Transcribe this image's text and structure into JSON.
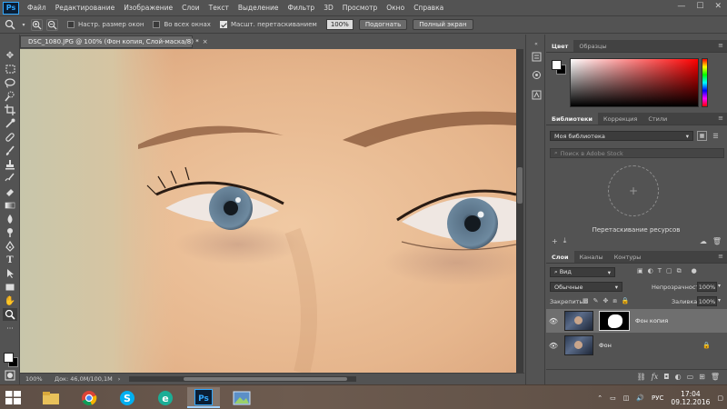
{
  "menubar": {
    "logo": "Ps",
    "items": [
      "Файл",
      "Редактирование",
      "Изображение",
      "Слои",
      "Текст",
      "Выделение",
      "Фильтр",
      "3D",
      "Просмотр",
      "Окно",
      "Справка"
    ],
    "controls": {
      "minimize": "—",
      "maximize": "☐",
      "close": "✕"
    }
  },
  "options": {
    "resize_windows_label": "Настр. размер окон",
    "resize_windows_checked": false,
    "all_windows_label": "Во всех окнах",
    "all_windows_checked": false,
    "scrubby_zoom_label": "Масшт. перетаскиванием",
    "scrubby_zoom_checked": true,
    "zoom_value": "100%",
    "fit_label": "Подогнать",
    "fullscreen_label": "Полный экран"
  },
  "document": {
    "tab_title": "DSC_1080.JPG @ 100% (Фон копия, Слой-маска/8) *",
    "close": "×",
    "status_zoom": "100%",
    "status_doc": "Док: 46,0M/100,1M",
    "status_arrow": "›"
  },
  "color_panel": {
    "tabs": [
      "Цвет",
      "Образцы"
    ],
    "active_tab": 0,
    "foreground": "#ffffff",
    "background": "#000000"
  },
  "libraries_panel": {
    "tabs": [
      "Библиотеки",
      "Коррекция",
      "Стили"
    ],
    "active_tab": 0,
    "library_name": "Моя библиотека",
    "search_placeholder": "Поиск в Adobe Stock",
    "plus": "+",
    "caption": "Перетаскивание ресурсов"
  },
  "layers_panel": {
    "tabs": [
      "Слои",
      "Каналы",
      "Контуры"
    ],
    "active_tab": 0,
    "filter_kind": "Вид",
    "blend_mode": "Обычные",
    "opacity_label": "Непрозрачность:",
    "opacity_value": "100%",
    "lock_label": "Закрепить:",
    "fill_label": "Заливка:",
    "fill_value": "100%",
    "layers": [
      {
        "name": "Фон копия",
        "visible": true,
        "selected": true,
        "has_mask": true
      },
      {
        "name": "Фон",
        "visible": true,
        "selected": false,
        "locked": true
      }
    ]
  },
  "taskbar": {
    "language": "РУС",
    "time": "17:04",
    "date": "09.12.2016"
  }
}
